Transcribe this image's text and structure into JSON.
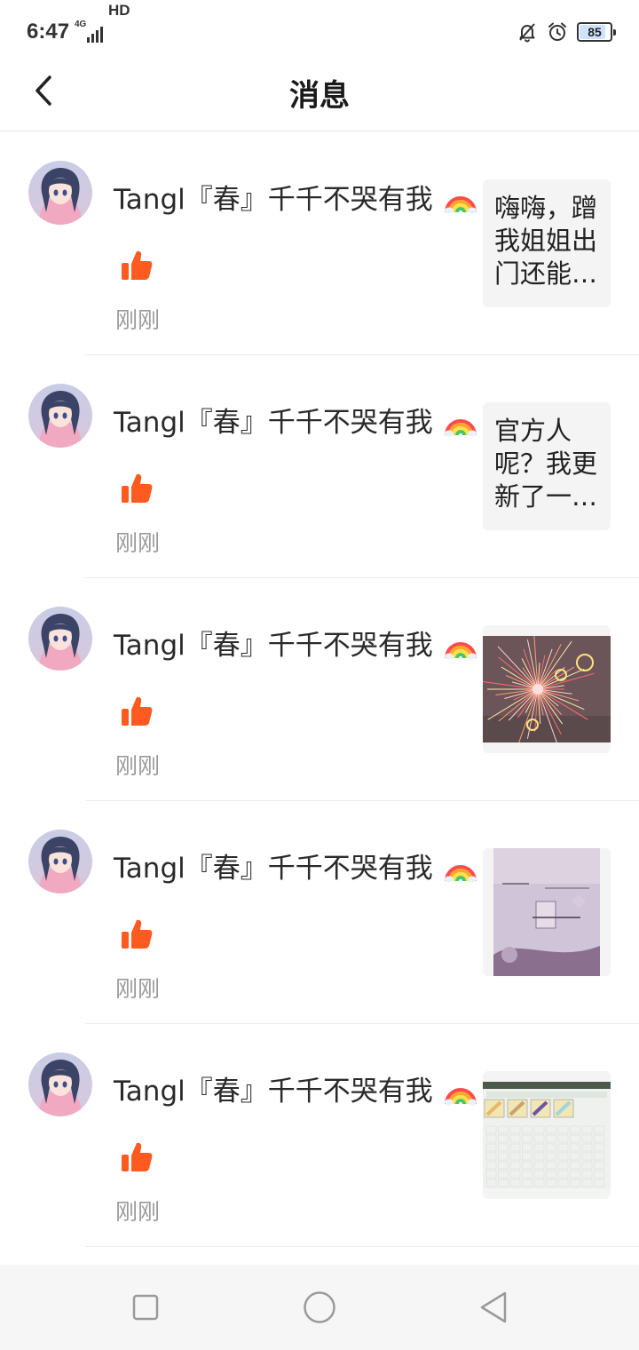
{
  "status_bar": {
    "time": "6:47",
    "network": "4G",
    "hd": "HD",
    "battery": "85",
    "battery_level": 0.85,
    "icons": [
      "mute-bell-icon",
      "alarm-icon"
    ]
  },
  "header": {
    "title": "消息",
    "back_icon": "chevron-left-icon"
  },
  "colors": {
    "like": "#ff5a1f",
    "divider": "#ececec",
    "time_text": "#9a9a9a",
    "preview_bg": "#f4f4f4",
    "nav_bg": "#f6f6f6"
  },
  "messages": [
    {
      "user": "Tangl『春』千千不哭有我",
      "emoji": "rainbow-icon",
      "action_icon": "thumbs-up-icon",
      "time": "刚刚",
      "preview_type": "text",
      "preview_text": "嗨嗨，蹭我姐姐出门还能喝彩"
    },
    {
      "user": "Tangl『春』千千不哭有我",
      "emoji": "rainbow-icon",
      "action_icon": "thumbs-up-icon",
      "time": "刚刚",
      "preview_type": "text",
      "preview_text": "官方人呢？我更新了一个新版"
    },
    {
      "user": "Tangl『春』千千不哭有我",
      "emoji": "rainbow-icon",
      "action_icon": "thumbs-up-icon",
      "time": "刚刚",
      "preview_type": "image",
      "preview_image": "fireworks-image"
    },
    {
      "user": "Tangl『春』千千不哭有我",
      "emoji": "rainbow-icon",
      "action_icon": "thumbs-up-icon",
      "time": "刚刚",
      "preview_type": "image",
      "preview_image": "love-note-image"
    },
    {
      "user": "Tangl『春』千千不哭有我",
      "emoji": "rainbow-icon",
      "action_icon": "thumbs-up-icon",
      "time": "刚刚",
      "preview_type": "image",
      "preview_image": "game-inventory-image"
    }
  ],
  "nav_bar": {
    "buttons": [
      "recent-apps-icon",
      "home-icon",
      "back-triangle-icon"
    ]
  }
}
